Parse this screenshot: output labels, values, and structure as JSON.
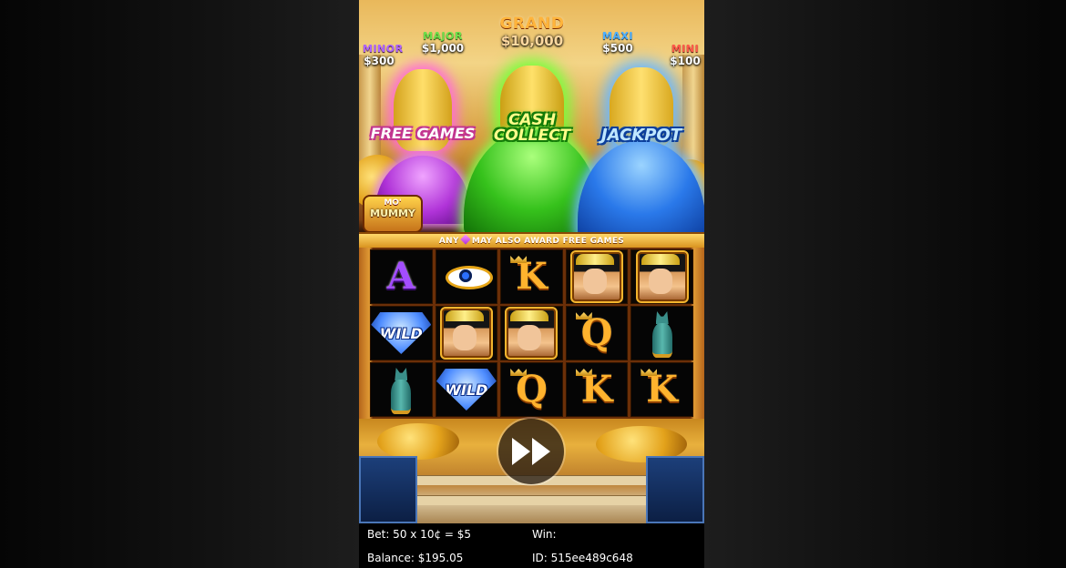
{
  "jackpots": {
    "minor": {
      "name": "MINOR",
      "value": "$300"
    },
    "major": {
      "name": "MAJOR",
      "value": "$1,000"
    },
    "grand": {
      "name": "GRAND",
      "value": "$10,000"
    },
    "maxi": {
      "name": "MAXI",
      "value": "$500"
    },
    "mini": {
      "name": "MINI",
      "value": "$100"
    }
  },
  "features": {
    "free_games": "FREE GAMES",
    "cash_collect": "CASH COLLECT",
    "jackpot": "JACKPOT"
  },
  "logo": {
    "line1": "MO'",
    "line2": "MUMMY"
  },
  "banner": {
    "before": "ANY",
    "after": "MAY ALSO AWARD FREE GAMES"
  },
  "reels": [
    [
      "A",
      "WILD",
      "cat"
    ],
    [
      "eye",
      "queen",
      "WILD"
    ],
    [
      "K",
      "queen",
      "Q"
    ],
    [
      "queen",
      "Q",
      "K"
    ],
    [
      "queen",
      "cat",
      "K"
    ]
  ],
  "colors": {
    "free_games_glow": "#ff6ad8",
    "cash_collect_glow": "#77ff3a",
    "jackpot_glow": "#6ab8ff"
  },
  "icons": {
    "spin": "fast-forward-icon"
  },
  "info": {
    "bet": "Bet: 50 x 10¢ = $5",
    "win": "Win:",
    "balance": "Balance: $195.05",
    "id": "ID: 515ee489c648"
  }
}
